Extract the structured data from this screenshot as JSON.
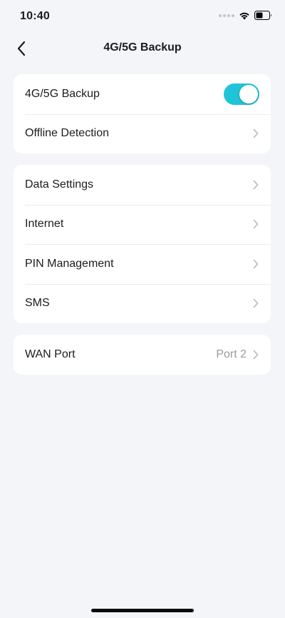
{
  "status_bar": {
    "time": "10:40"
  },
  "header": {
    "title": "4G/5G Backup"
  },
  "group1": {
    "backup_toggle": {
      "label": "4G/5G Backup",
      "enabled": true
    },
    "offline_detection": {
      "label": "Offline Detection"
    }
  },
  "group2": {
    "items": [
      {
        "label": "Data Settings"
      },
      {
        "label": "Internet"
      },
      {
        "label": "PIN Management"
      },
      {
        "label": "SMS"
      }
    ]
  },
  "group3": {
    "wan_port": {
      "label": "WAN Port",
      "value": "Port 2"
    }
  },
  "colors": {
    "accent": "#1fc4d8",
    "background": "#f4f5f9",
    "card": "#ffffff",
    "secondary_text": "#9a9aa0"
  }
}
